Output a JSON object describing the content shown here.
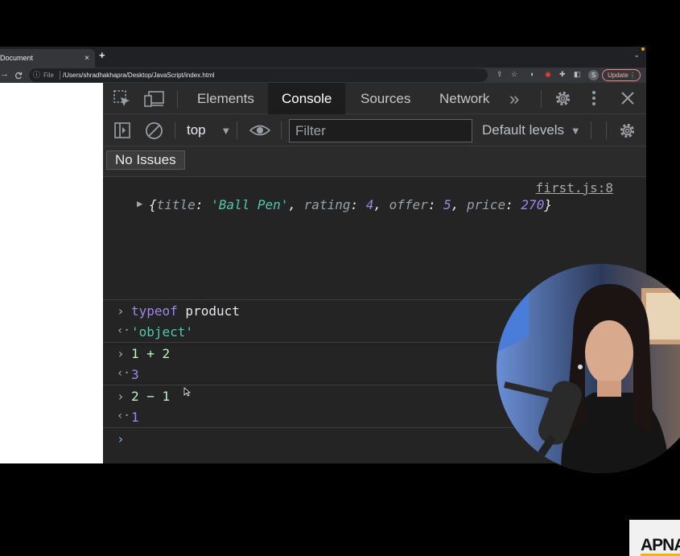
{
  "browser": {
    "tab_title": "Document",
    "tab_close": "×",
    "new_tab": "+",
    "tab_menu": "⌄",
    "nav": {
      "forward": "→",
      "reload": "C"
    },
    "omnibox": {
      "scheme_label": "File",
      "url": "/Users/shradhakhapra/Desktop/JavaScript/index.html"
    },
    "profile_initial": "S",
    "update_label": "Update",
    "update_menu": "⋮"
  },
  "devtools": {
    "tabs": [
      "Elements",
      "Console",
      "Sources",
      "Network"
    ],
    "active_tab": "Console",
    "more_tabs": "»",
    "toolbar": {
      "context": "top",
      "filter_placeholder": "Filter",
      "levels": "Default levels"
    },
    "issues_label": "No Issues",
    "console": {
      "source_link": "first.js:8",
      "object_log": {
        "title_key": "title",
        "title_value": "'Ball Pen'",
        "rating_key": "rating",
        "rating_value": "4",
        "offer_key": "offer",
        "offer_value": "5",
        "price_key": "price",
        "price_value": "270"
      },
      "entries": [
        {
          "input_kw": "typeof",
          "input_rest": " product",
          "output": "'object'"
        },
        {
          "input": "1 + 2",
          "output": "3"
        },
        {
          "input": "2 − 1",
          "output": "1"
        }
      ],
      "prompt_chevron": "›"
    }
  },
  "logo_text": "APNA",
  "colors": {
    "devtools_bg": "#242424",
    "toolbar_bg": "#2b2b2b",
    "string": "#4ec9b0",
    "number": "#9d88e8",
    "keyword": "#9d88e8"
  }
}
